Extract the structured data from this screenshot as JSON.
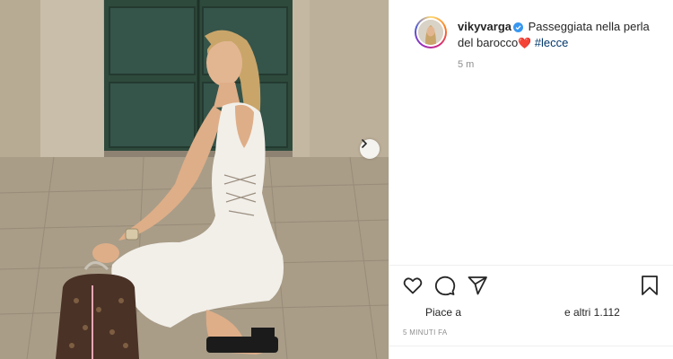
{
  "post": {
    "username": "vikyvarga",
    "caption_text": "Passeggiata nella perla del barocco",
    "caption_emoji": "❤️",
    "hashtag": "#lecce",
    "time_ago": "5 m",
    "likes_prefix": "Piace a",
    "likes_suffix": "e altri 1.112",
    "timestamp": "5 MINUTI FA"
  },
  "colors": {
    "verified": "#3897f0",
    "hashtag": "#00376b",
    "secondary_text": "#8e8e8e"
  },
  "icons": {
    "like": "heart-outline-icon",
    "comment": "speech-bubble-icon",
    "share": "paper-plane-icon",
    "save": "bookmark-icon",
    "next": "chevron-right-icon"
  }
}
